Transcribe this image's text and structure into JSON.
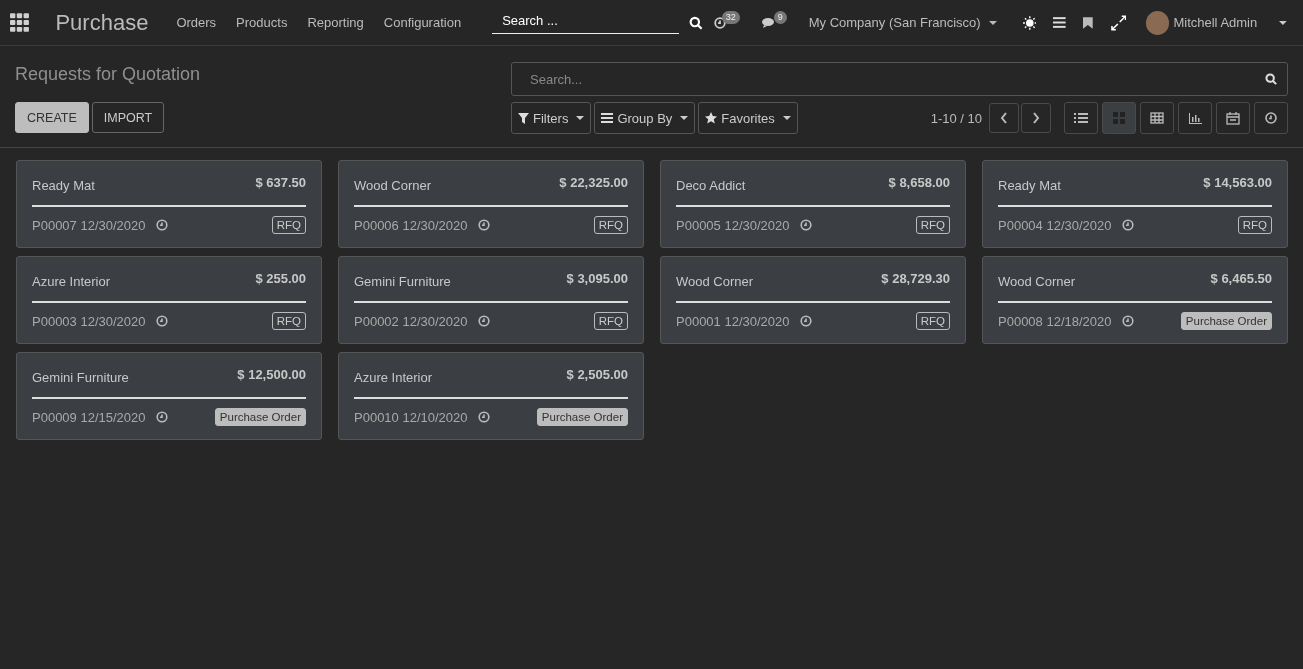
{
  "navbar": {
    "app_name": "Purchase",
    "menus": [
      "Orders",
      "Products",
      "Reporting",
      "Configuration"
    ],
    "search": {
      "value": "Search ..."
    },
    "activity_count": "32",
    "message_count": "9",
    "company": "My Company (San Francisco)",
    "user": "Mitchell Admin"
  },
  "control_panel": {
    "title": "Requests for Quotation",
    "buttons": [
      {
        "label": "CREATE",
        "kind": "primary"
      },
      {
        "label": "IMPORT",
        "kind": "secondary"
      }
    ],
    "search": {
      "placeholder": "Search..."
    },
    "filters": [
      "Filters",
      "Group By",
      "Favorites"
    ],
    "pager": "1-10 / 10",
    "views": [
      {
        "kind": "list",
        "selected": false
      },
      {
        "kind": "kanban",
        "selected": true
      },
      {
        "kind": "grid",
        "selected": false
      },
      {
        "kind": "graph",
        "selected": false
      },
      {
        "kind": "calendar",
        "selected": false
      },
      {
        "kind": "activity",
        "selected": false
      }
    ]
  },
  "cards": [
    {
      "vendor": "Ready Mat",
      "amount": "$ 637.50",
      "reference": "P00007 12/30/2020",
      "status": "RFQ",
      "kind": "rfq"
    },
    {
      "vendor": "Wood Corner",
      "amount": "$ 22,325.00",
      "reference": "P00006 12/30/2020",
      "status": "RFQ",
      "kind": "rfq"
    },
    {
      "vendor": "Deco Addict",
      "amount": "$ 8,658.00",
      "reference": "P00005 12/30/2020",
      "status": "RFQ",
      "kind": "rfq"
    },
    {
      "vendor": "Ready Mat",
      "amount": "$ 14,563.00",
      "reference": "P00004 12/30/2020",
      "status": "RFQ",
      "kind": "rfq"
    },
    {
      "vendor": "Azure Interior",
      "amount": "$ 255.00",
      "reference": "P00003 12/30/2020",
      "status": "RFQ",
      "kind": "rfq"
    },
    {
      "vendor": "Gemini Furniture",
      "amount": "$ 3,095.00",
      "reference": "P00002 12/30/2020",
      "status": "RFQ",
      "kind": "rfq"
    },
    {
      "vendor": "Wood Corner",
      "amount": "$ 28,729.30",
      "reference": "P00001 12/30/2020",
      "status": "RFQ",
      "kind": "rfq"
    },
    {
      "vendor": "Wood Corner",
      "amount": "$ 6,465.50",
      "reference": "P00008 12/18/2020",
      "status": "Purchase Order",
      "kind": "order"
    },
    {
      "vendor": "Gemini Furniture",
      "amount": "$ 12,500.00",
      "reference": "P00009 12/15/2020",
      "status": "Purchase Order",
      "kind": "order"
    },
    {
      "vendor": "Azure Interior",
      "amount": "$ 2,505.00",
      "reference": "P00010 12/10/2020",
      "status": "Purchase Order",
      "kind": "order"
    }
  ]
}
